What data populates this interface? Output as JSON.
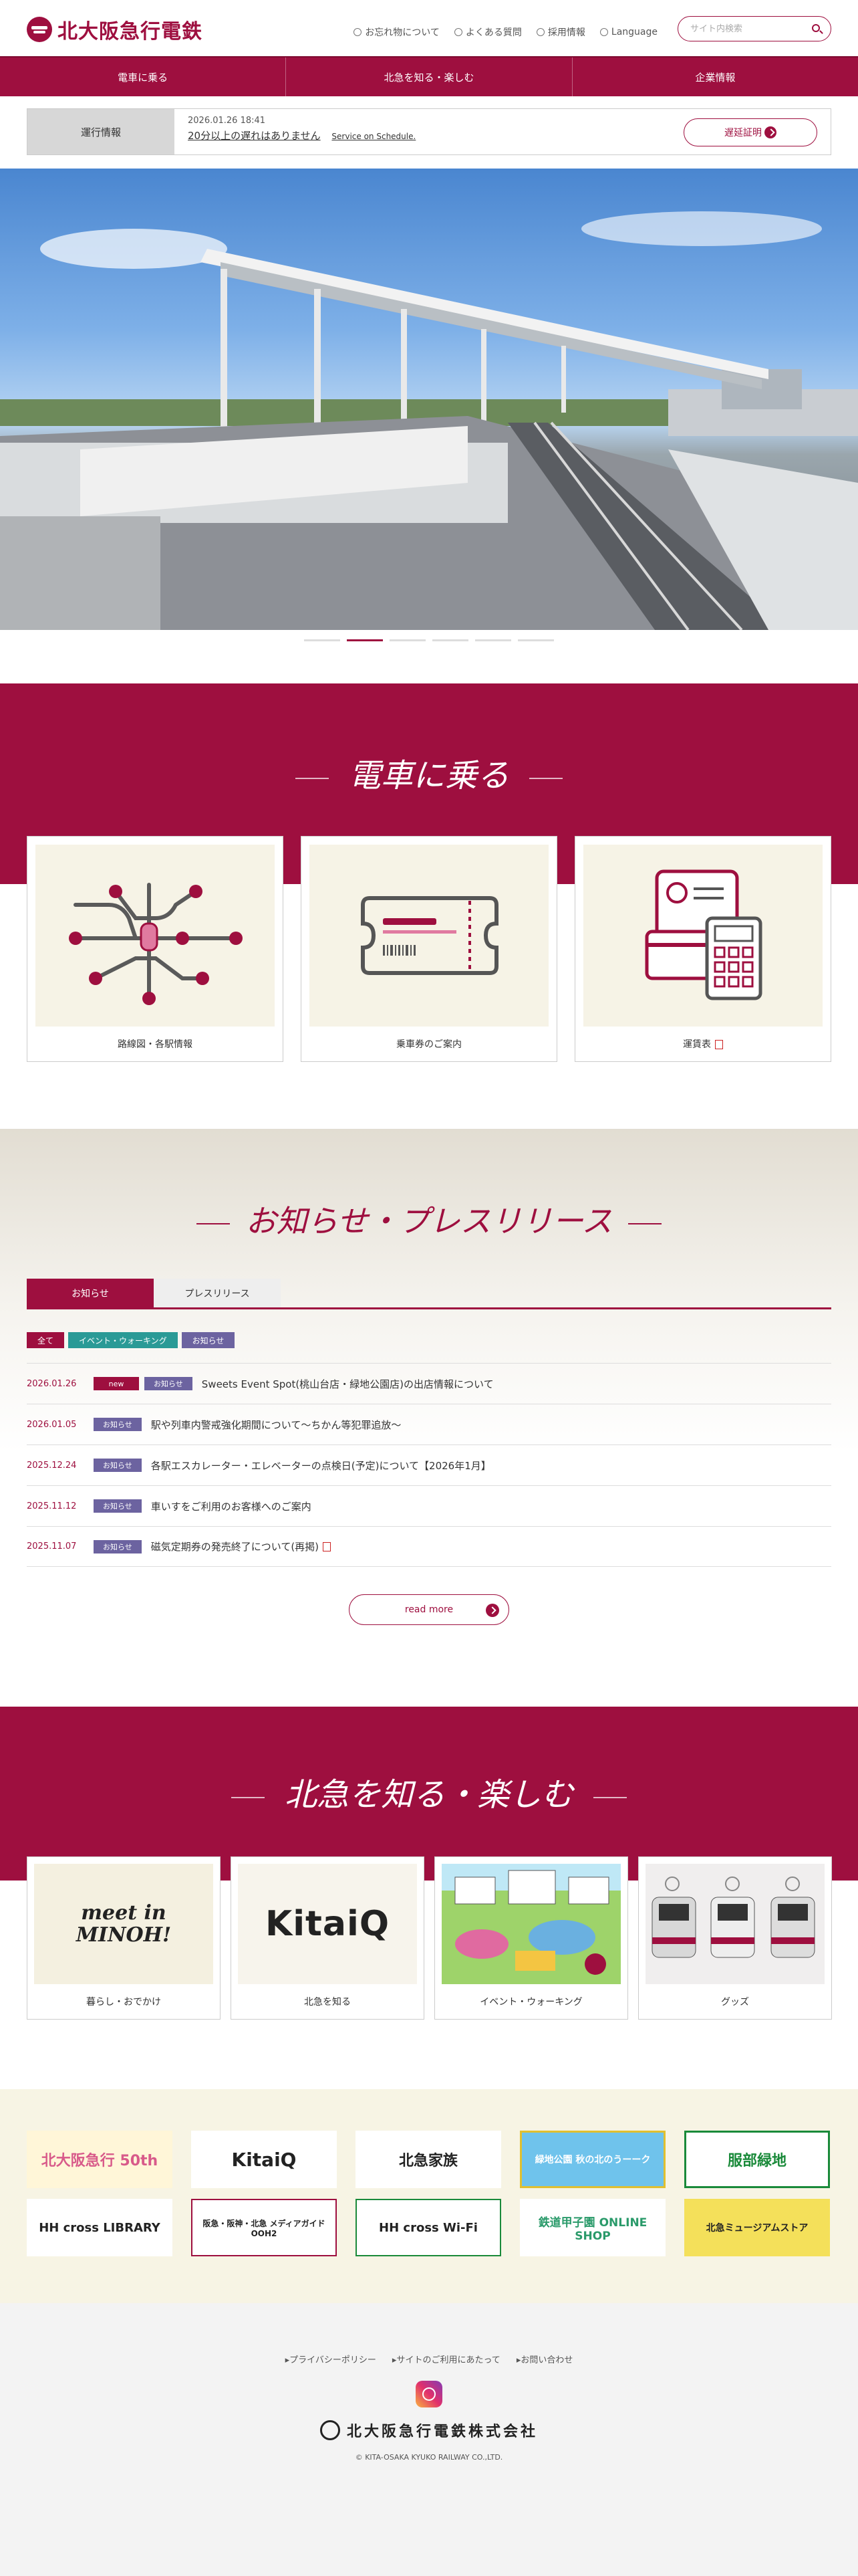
{
  "header": {
    "logo_text": "北大阪急行電鉄",
    "links": [
      "お忘れ物について",
      "よくある質問",
      "採用情報",
      "Language"
    ],
    "search_placeholder": "サイト内検索"
  },
  "nav": [
    "電車に乗る",
    "北急を知る・楽しむ",
    "企業情報"
  ],
  "operation": {
    "label": "運行情報",
    "time": "2026.01.26 18:41",
    "status": "20分以上の遅れはありません",
    "status_en": "Service on Schedule.",
    "button": "遅延証明"
  },
  "section_ride": {
    "title": "電車に乗る",
    "cards": [
      "路線図・各駅情報",
      "乗車券のご案内",
      "運賃表"
    ]
  },
  "news": {
    "title": "お知らせ・プレスリリース",
    "tabs": [
      "お知らせ",
      "プレスリリース"
    ],
    "filters": [
      "全て",
      "イベント・ウォーキング",
      "お知らせ"
    ],
    "items": [
      {
        "date": "2026.01.26",
        "badges": [
          "new",
          "お知らせ"
        ],
        "title": "Sweets Event Spot(桃山台店・緑地公園店)の出店情報について"
      },
      {
        "date": "2026.01.05",
        "badges": [
          "お知らせ"
        ],
        "title": "駅や列車内警戒強化期間について～ちかん等犯罪追放～"
      },
      {
        "date": "2025.12.24",
        "badges": [
          "お知らせ"
        ],
        "title": "各駅エスカレーター・エレベーターの点検日(予定)について【2026年1月】"
      },
      {
        "date": "2025.11.12",
        "badges": [
          "お知らせ"
        ],
        "title": "車いすをご利用のお客様へのご案内"
      },
      {
        "date": "2025.11.07",
        "badges": [
          "お知らせ"
        ],
        "title": "磁気定期券の発売終了について(再掲)"
      }
    ],
    "read_more": "read more"
  },
  "section_enjoy": {
    "title": "北急を知る・楽しむ",
    "cards": [
      {
        "label": "暮らし・おでかけ",
        "img_text": "meet in MINOH!"
      },
      {
        "label": "北急を知る",
        "img_text": "KitaiQ"
      },
      {
        "label": "イベント・ウォーキング"
      },
      {
        "label": "グッズ"
      }
    ]
  },
  "banners": [
    "北大阪急行 50th",
    "KitaiQ",
    "北急家族",
    "緑地公園 秋の北のうーーク",
    "服部緑地",
    "HH cross LIBRARY",
    "阪急・阪神・北急 メディアガイド OOH2",
    "HH cross Wi-Fi",
    "鉄道甲子園 ONLINE SHOP",
    "北急ミュージアムストア"
  ],
  "footer": {
    "links": [
      "プライバシーポリシー",
      "サイトのご利用にあたって",
      "お問い合わせ"
    ],
    "company": "北大阪急行電鉄株式会社",
    "copyright": "© KITA-OSAKA KYUKO RAILWAY CO.,LTD."
  }
}
